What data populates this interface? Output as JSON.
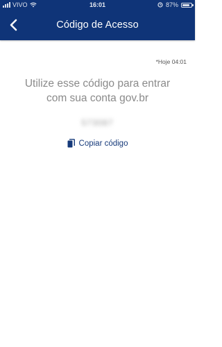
{
  "status_bar": {
    "carrier": "VIVO",
    "time": "16:01",
    "battery": "87%",
    "battery_level": 0.87
  },
  "header": {
    "title": "Código de Acesso"
  },
  "main": {
    "timestamp": "*Hoje 04:01",
    "instructions": "Utilize esse código para entrar com sua conta gov.br",
    "code": "573087",
    "copy_label": "Copiar código"
  },
  "colors": {
    "header_bg": "#0f3478",
    "link": "#163a7a",
    "body_text": "#8a8a8a"
  }
}
